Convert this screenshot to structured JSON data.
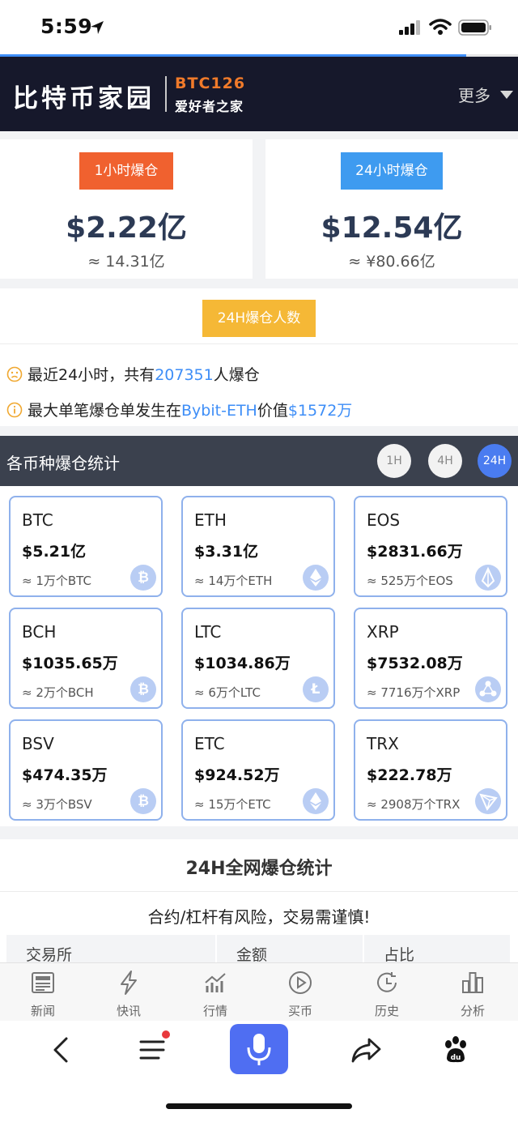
{
  "status_bar": {
    "time": "5:59"
  },
  "progress": {
    "fraction": 0.9
  },
  "header": {
    "logo_cn": "比特币家园",
    "logo_en": "BTC126",
    "logo_sub": "爱好者之家",
    "more": "更多"
  },
  "liquidation": {
    "hour": {
      "badge": "1小时爆仓",
      "amount": "$2.22亿",
      "approx": "≈ 14.31亿",
      "color": "#f0612f"
    },
    "day": {
      "badge": "24小时爆仓",
      "amount": "$12.54亿",
      "approx": "≈ ¥80.66亿",
      "color": "#3e9bf0"
    }
  },
  "people": {
    "badge": "24H爆仓人数",
    "line1": {
      "prefix": "最近24小时，共有",
      "count": "207351",
      "suffix": "人爆仓"
    },
    "line2": {
      "prefix": "最大单笔爆仓单发生在",
      "exchange": "Bybit-ETH",
      "mid": "价值",
      "value": "$1572万"
    }
  },
  "coin_section": {
    "title": "各币种爆仓统计",
    "periods": [
      "1H",
      "4H",
      "24H"
    ],
    "active_period": "24H"
  },
  "coins": [
    {
      "symbol": "BTC",
      "amount": "$5.21亿",
      "qty": "≈ 1万个BTC",
      "icon": "bitcoin-icon"
    },
    {
      "symbol": "ETH",
      "amount": "$3.31亿",
      "qty": "≈ 14万个ETH",
      "icon": "ethereum-icon"
    },
    {
      "symbol": "EOS",
      "amount": "$2831.66万",
      "qty": "≈ 525万个EOS",
      "icon": "eos-icon"
    },
    {
      "symbol": "BCH",
      "amount": "$1035.65万",
      "qty": "≈ 2万个BCH",
      "icon": "bitcoin-cash-icon"
    },
    {
      "symbol": "LTC",
      "amount": "$1034.86万",
      "qty": "≈ 6万个LTC",
      "icon": "litecoin-icon"
    },
    {
      "symbol": "XRP",
      "amount": "$7532.08万",
      "qty": "≈ 7716万个XRP",
      "icon": "ripple-icon"
    },
    {
      "symbol": "BSV",
      "amount": "$474.35万",
      "qty": "≈ 3万个BSV",
      "icon": "bitcoin-sv-icon"
    },
    {
      "symbol": "ETC",
      "amount": "$924.52万",
      "qty": "≈ 15万个ETC",
      "icon": "ethereum-classic-icon"
    },
    {
      "symbol": "TRX",
      "amount": "$222.78万",
      "qty": "≈ 2908万个TRX",
      "icon": "tron-icon"
    }
  ],
  "network": {
    "title": "24H全网爆仓统计",
    "warning": "合约/杠杆有风险，交易需谨慎!",
    "columns": [
      "交易所",
      "金额",
      "占比"
    ]
  },
  "tabs": [
    {
      "label": "新闻",
      "icon": "newspaper-icon"
    },
    {
      "label": "快讯",
      "icon": "lightning-icon"
    },
    {
      "label": "行情",
      "icon": "chart-icon"
    },
    {
      "label": "买币",
      "icon": "play-icon"
    },
    {
      "label": "历史",
      "icon": "history-icon"
    },
    {
      "label": "分析",
      "icon": "bar-chart-icon"
    }
  ],
  "browser_bar": {
    "icons": [
      "back-icon",
      "menu-icon",
      "microphone-icon",
      "share-icon",
      "baidu-paw-icon"
    ]
  }
}
